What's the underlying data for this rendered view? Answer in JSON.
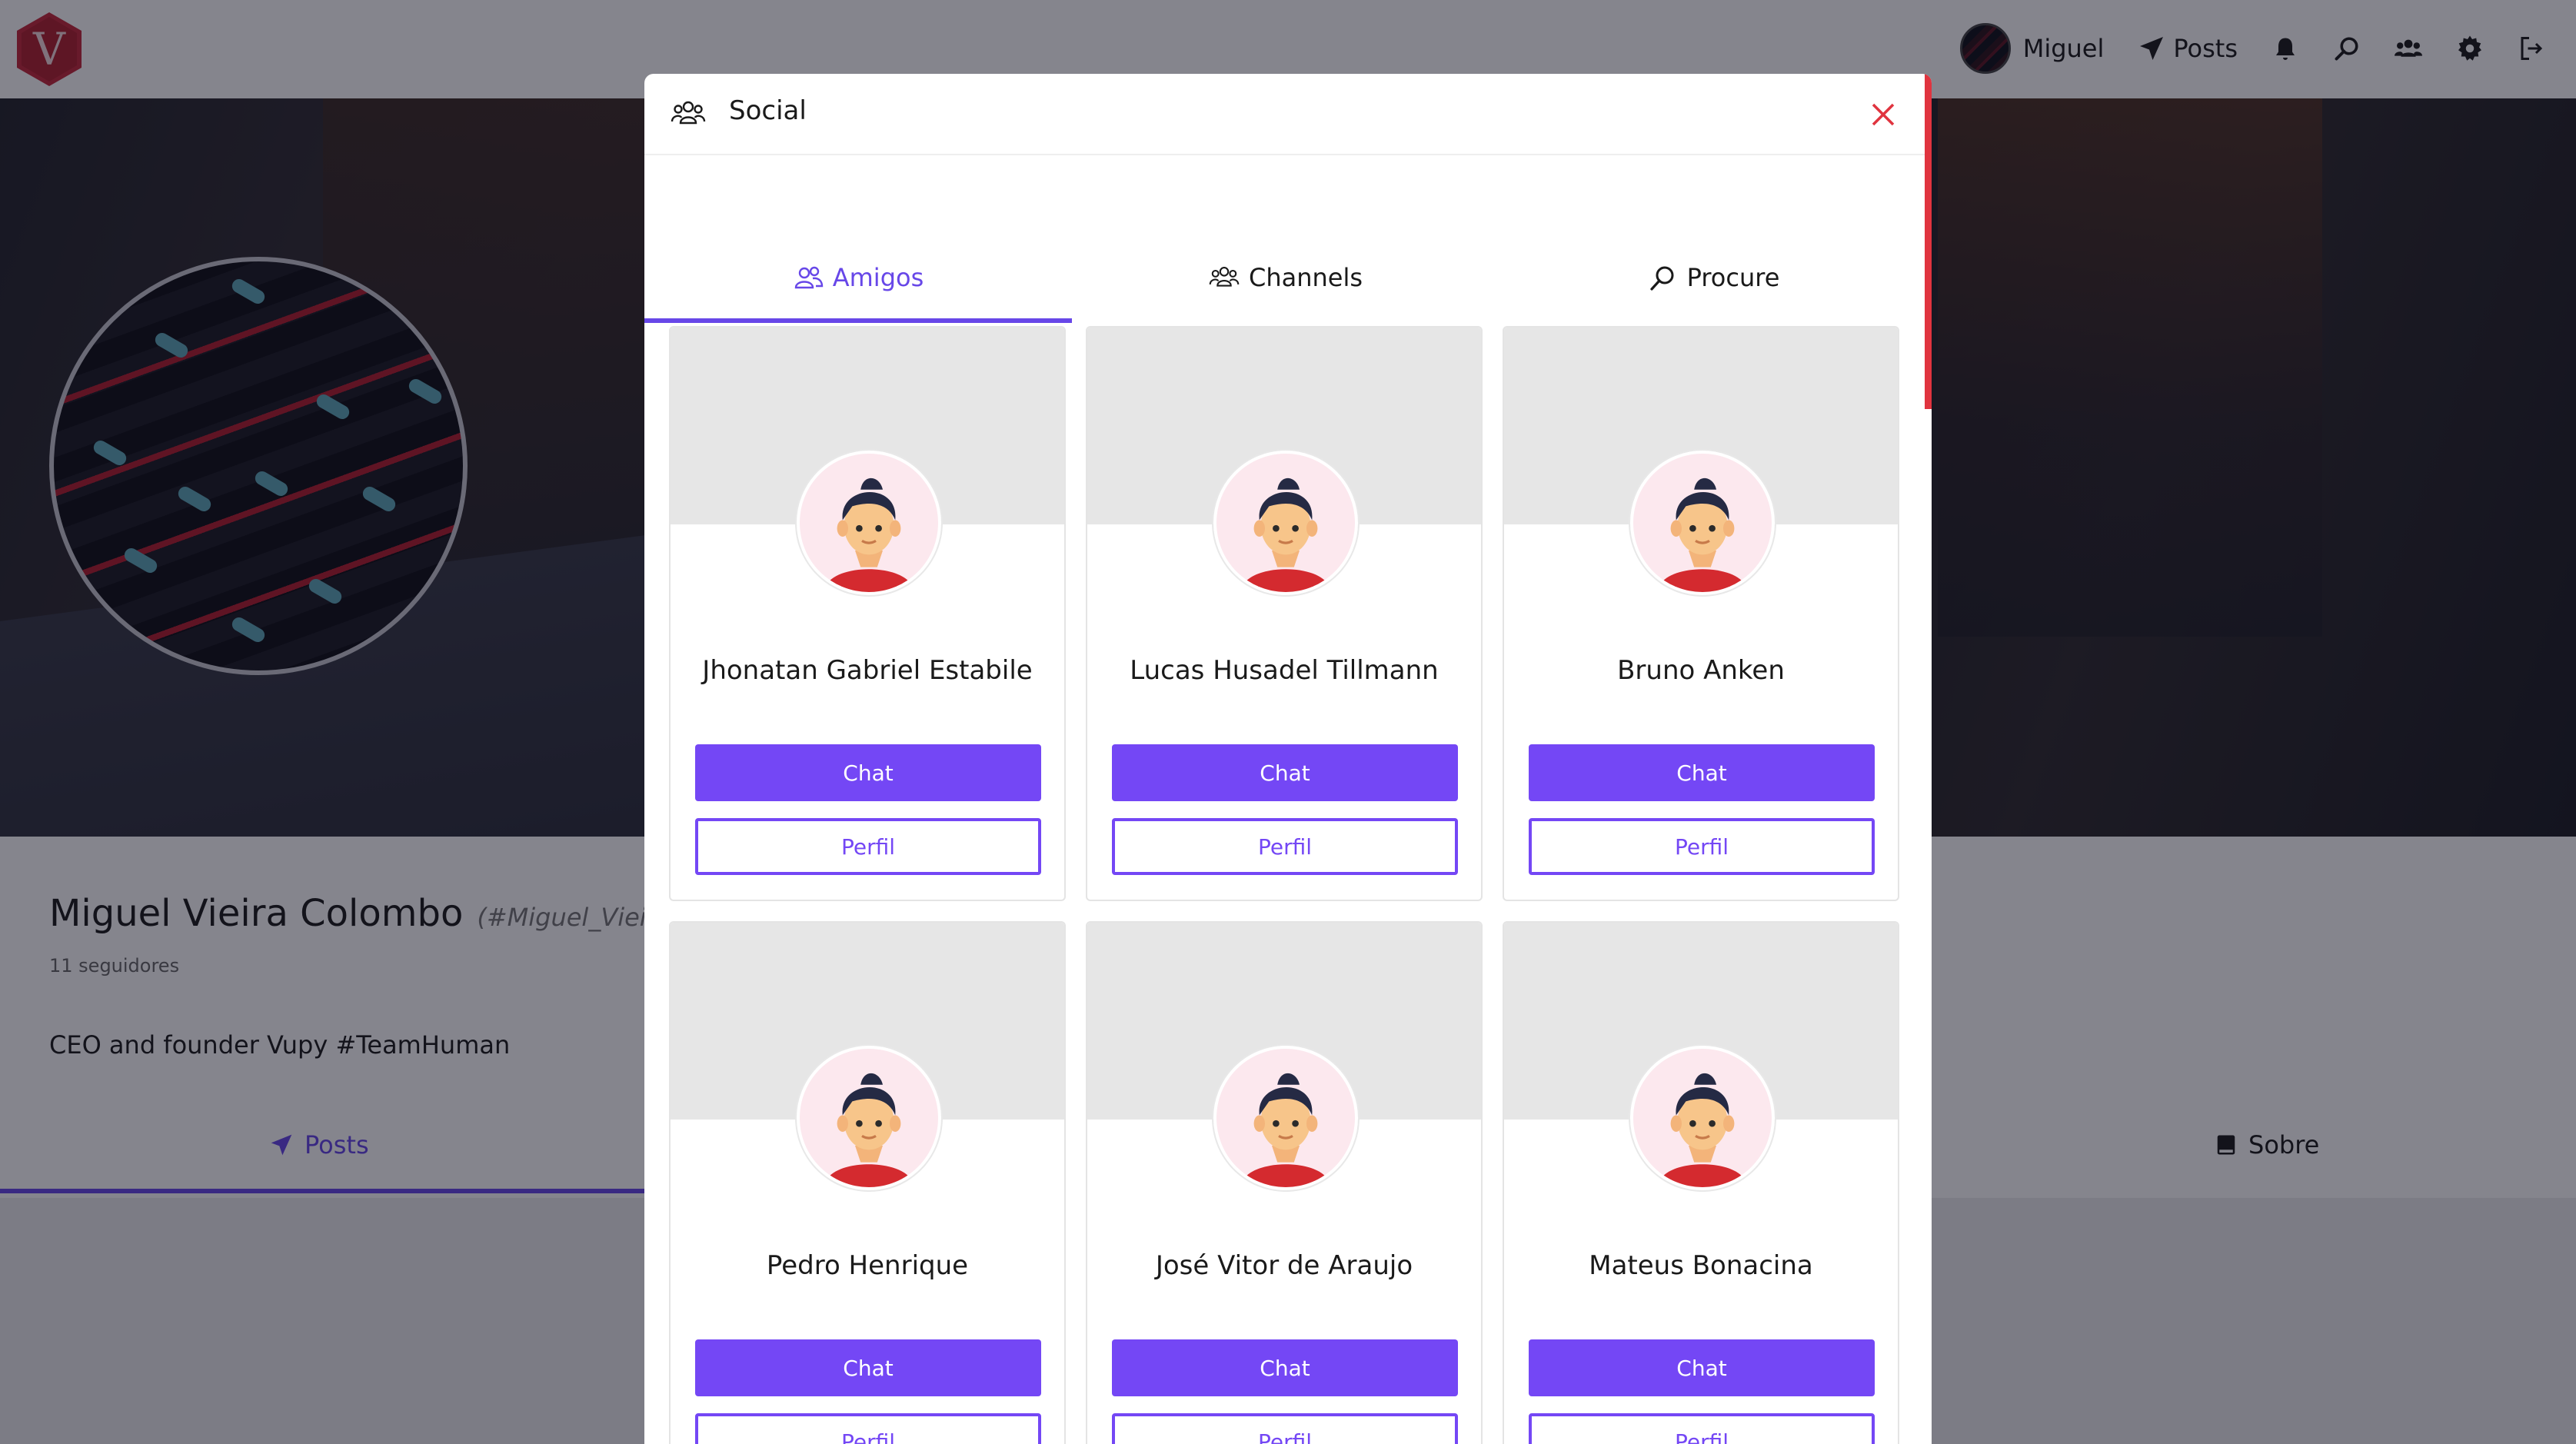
{
  "topbar": {
    "logo_letter": "V",
    "user_name": "Miguel",
    "posts_label": "Posts",
    "icons": [
      "bell-icon",
      "search-icon",
      "users-icon",
      "gear-icon",
      "logout-icon"
    ]
  },
  "profile": {
    "name": "Miguel Vieira Colombo",
    "handle": "(#Miguel_Vieira_Co",
    "followers": "11 seguidores",
    "bio": "CEO and founder Vupy #TeamHuman",
    "tabs": {
      "posts": "Posts",
      "sobre": "Sobre"
    }
  },
  "modal": {
    "title": "Social",
    "tabs": [
      {
        "label": "Amigos",
        "icon": "friends-icon",
        "active": true
      },
      {
        "label": "Channels",
        "icon": "group-icon",
        "active": false
      },
      {
        "label": "Procure",
        "icon": "search-icon",
        "active": false
      }
    ],
    "friends": [
      {
        "name": "Jhonatan Gabriel Estabile",
        "chat": "Chat",
        "perfil": "Perfil"
      },
      {
        "name": "Lucas Husadel Tillmann",
        "chat": "Chat",
        "perfil": "Perfil"
      },
      {
        "name": "Bruno Anken",
        "chat": "Chat",
        "perfil": "Perfil"
      },
      {
        "name": "Pedro Henrique",
        "chat": "Chat",
        "perfil": "Perfil"
      },
      {
        "name": "José Vitor de Araujo",
        "chat": "Chat",
        "perfil": "Perfil"
      },
      {
        "name": "Mateus Bonacina",
        "chat": "Chat",
        "perfil": "Perfil"
      }
    ]
  },
  "colors": {
    "accent": "#6747e8",
    "button": "#7447f5",
    "close": "#e0343f",
    "brand": "#c4283a"
  }
}
